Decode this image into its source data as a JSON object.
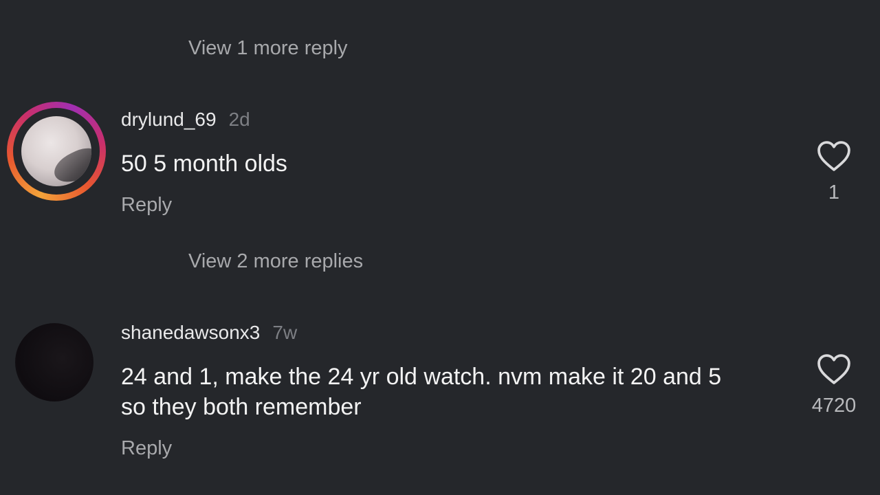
{
  "thread_top": {
    "view_more_label": "View 1 more reply"
  },
  "comments": [
    {
      "username": "drylund_69",
      "timestamp": "2d",
      "text": "50 5 month olds",
      "reply_label": "Reply",
      "likes": "1",
      "view_more_label": "View 2 more replies",
      "avatar_has_story_ring": true
    },
    {
      "username": "shanedawsonx3",
      "timestamp": "7w",
      "text": "24 and 1, make the 24 yr old watch. nvm make it 20 and 5 so they both remember",
      "reply_label": "Reply",
      "likes": "4720",
      "avatar_has_story_ring": false
    }
  ],
  "icons": {
    "like": "heart-outline-icon"
  },
  "colors": {
    "background": "#25272b",
    "text_primary": "#f3f3f3",
    "text_secondary": "#a8a9ac",
    "timestamp": "#7d7f84"
  }
}
